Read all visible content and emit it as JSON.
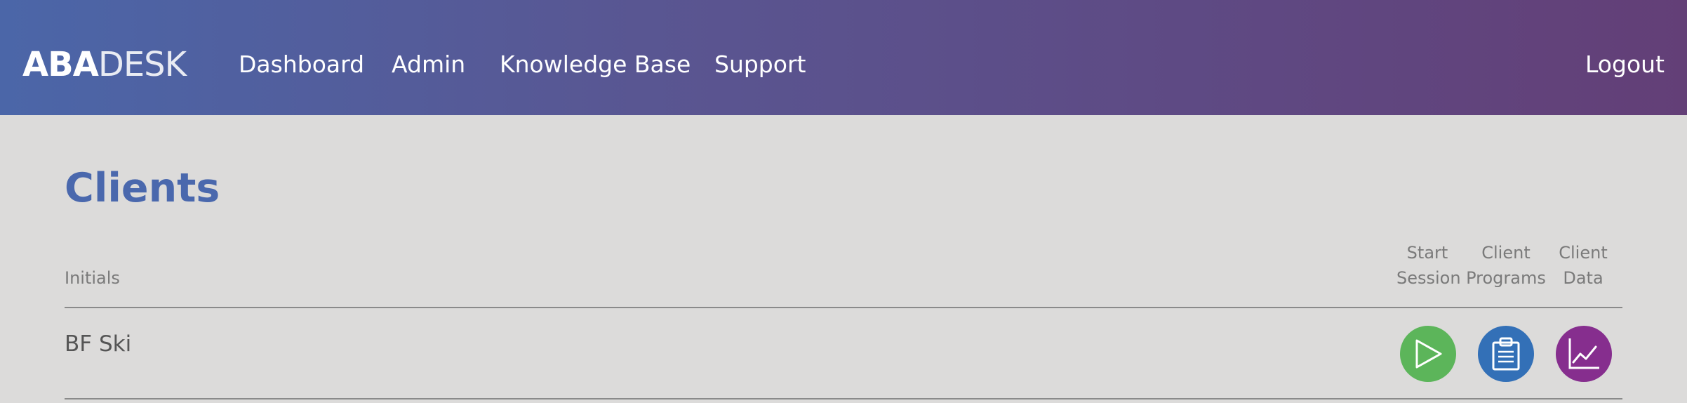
{
  "app": {
    "logo_bold": "ABA",
    "logo_light": "DESK"
  },
  "nav": {
    "items": [
      {
        "label": "Dashboard"
      },
      {
        "label": "Admin"
      },
      {
        "label": "Knowledge Base"
      },
      {
        "label": "Support"
      }
    ],
    "logout_label": "Logout"
  },
  "page": {
    "title": "Clients"
  },
  "table": {
    "headers": {
      "initials": "Initials",
      "start_session_line1": "Start",
      "start_session_line2": "Session",
      "client_programs_line1": "Client",
      "client_programs_line2": "Programs",
      "client_data_line1": "Client",
      "client_data_line2": "Data"
    },
    "rows": [
      {
        "initials": "BF Ski"
      }
    ]
  },
  "actions": {
    "start_session": {
      "icon": "play-icon",
      "color": "#5cb55a"
    },
    "client_programs": {
      "icon": "clipboard-icon",
      "color": "#3370b7"
    },
    "client_data": {
      "icon": "line-chart-icon",
      "color": "#862e8e"
    }
  }
}
